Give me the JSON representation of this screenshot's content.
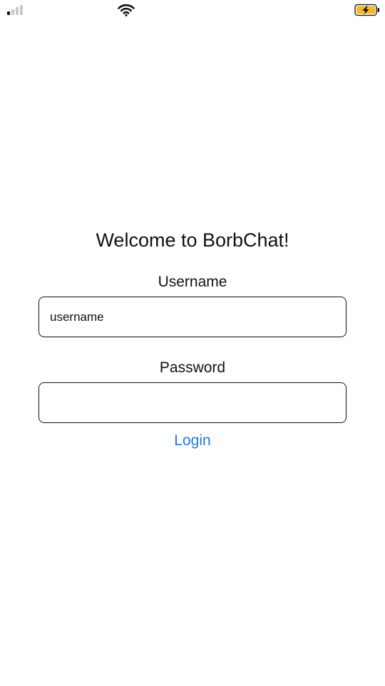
{
  "status_bar": {
    "signal_icon": "cellular-signal-icon",
    "wifi_icon": "wifi-icon",
    "battery_icon": "battery-charging-icon",
    "battery_color": "#f5b829"
  },
  "login": {
    "title": "Welcome to BorbChat!",
    "username_label": "Username",
    "username_placeholder": "username",
    "username_value": "",
    "password_label": "Password",
    "password_placeholder": "",
    "password_value": "",
    "login_label": "Login"
  },
  "colors": {
    "accent": "#1f7ae0",
    "text": "#111111",
    "background": "#ffffff"
  }
}
